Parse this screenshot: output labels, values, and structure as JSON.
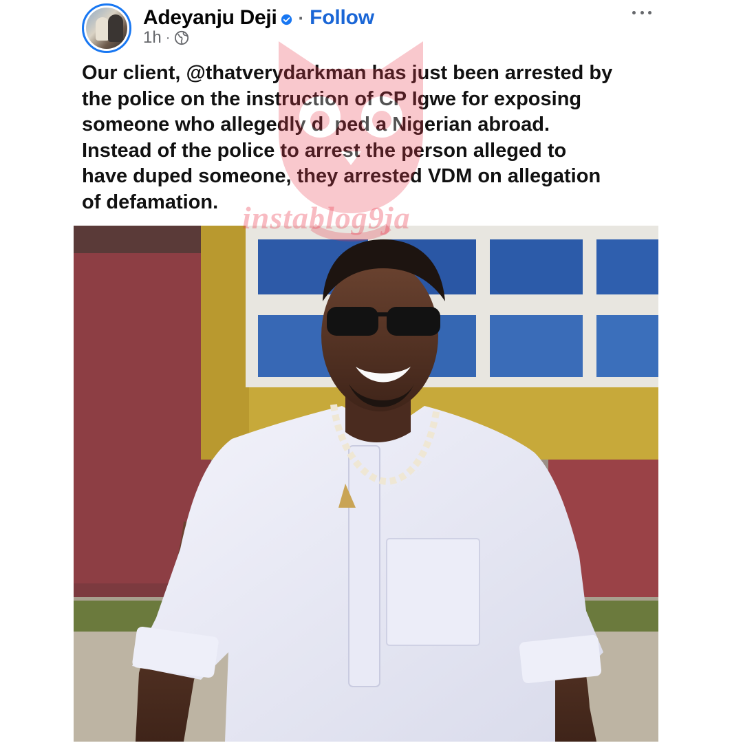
{
  "post": {
    "author_name": "Adeyanju Deji",
    "separator": "·",
    "follow_label": "Follow",
    "timestamp": "1h",
    "meta_separator": "·",
    "body_lines": [
      "Our client, @thatverydarkman has just been arrested by",
      "the police on the instruction of CP Igwe for exposing",
      "someone who allegedly d  ped a Nigerian abroad.",
      "Instead of the police to arrest the person alleged to",
      "have duped someone, they arrested VDM on allegation",
      "of defamation."
    ]
  },
  "icons": {
    "verified": "verified-badge-icon",
    "audience": "globe-icon",
    "more": "more-horizontal-icon"
  },
  "watermark": {
    "text": "instablog9ja"
  },
  "colors": {
    "follow": "#1a66d6",
    "verified": "#1877f2",
    "meta": "#65676b",
    "watermark": "#eb3c50"
  }
}
